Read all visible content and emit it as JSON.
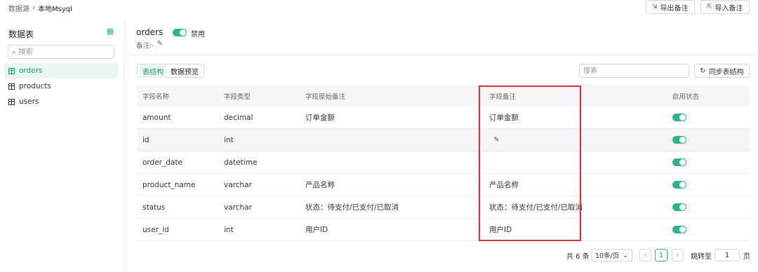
{
  "breadcrumb": {
    "root": "数据源",
    "current": "本地Msyql"
  },
  "top_actions": {
    "export_label": "导出备注",
    "import_label": "导入备注"
  },
  "sidebar": {
    "title": "数据表",
    "search_placeholder": "搜索",
    "items": [
      {
        "label": "orders",
        "active": true
      },
      {
        "label": "products",
        "active": false
      },
      {
        "label": "users",
        "active": false
      }
    ]
  },
  "table_header": {
    "name": "orders",
    "status_label": "禁用",
    "enabled": true,
    "note_label": "备注:-"
  },
  "tabs": [
    {
      "label": "表结构",
      "active": true
    },
    {
      "label": "数据预览",
      "active": false
    }
  ],
  "toolbar": {
    "search_placeholder": "搜索",
    "sync_label": "同步表结构"
  },
  "columns": [
    "字段名称",
    "字段类型",
    "字段原始备注",
    "字段备注",
    "启用状态"
  ],
  "rows": [
    {
      "name": "amount",
      "type": "decimal",
      "original_note": "订单金额",
      "note": "订单金额",
      "enabled": true
    },
    {
      "name": "id",
      "type": "int",
      "original_note": "",
      "note": "",
      "enabled": true,
      "editing": true
    },
    {
      "name": "order_date",
      "type": "datetime",
      "original_note": "",
      "note": "",
      "enabled": true
    },
    {
      "name": "product_name",
      "type": "varchar",
      "original_note": "产品名称",
      "note": "产品名称",
      "enabled": true
    },
    {
      "name": "status",
      "type": "varchar",
      "original_note": "状态：待支付/已支付/已取消",
      "note": "状态：待支付/已支付/已取消",
      "enabled": true
    },
    {
      "name": "user_id",
      "type": "int",
      "original_note": "用户ID",
      "note": "用户ID",
      "enabled": true
    }
  ],
  "pagination": {
    "total_text": "共 6 条",
    "page_size": "10条/页",
    "current_page": "1",
    "jump_label": "跳转至",
    "jump_value": "1",
    "page_unit": "页"
  },
  "colors": {
    "accent": "#2bb686",
    "highlight_border": "#e03131"
  }
}
